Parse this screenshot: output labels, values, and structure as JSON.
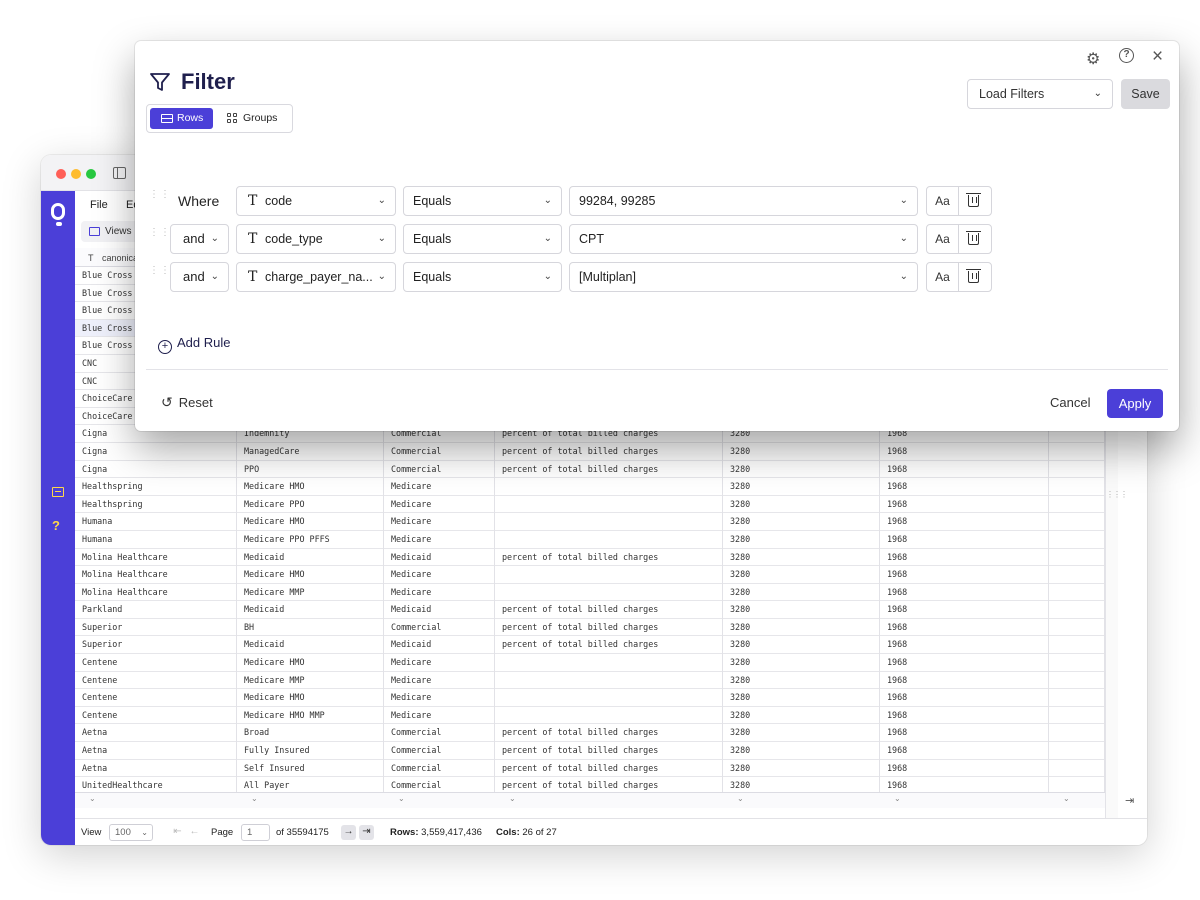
{
  "app": {
    "menu": [
      "File",
      "Ed"
    ],
    "views_label": "Views",
    "first_column_header": "canonica",
    "grid_rows": [
      [
        "Blue Cross",
        "",
        "",
        "",
        "",
        "",
        ""
      ],
      [
        "Blue Cross",
        "",
        "",
        "",
        "",
        "",
        ""
      ],
      [
        "Blue Cross",
        "",
        "",
        "",
        "",
        "",
        ""
      ],
      [
        "Blue Cross",
        "",
        "",
        "",
        "",
        "",
        ""
      ],
      [
        "Blue Cross",
        "",
        "",
        "",
        "",
        "",
        ""
      ],
      [
        "CNC",
        "",
        "",
        "",
        "",
        "",
        ""
      ],
      [
        "CNC",
        "",
        "",
        "",
        "",
        "",
        ""
      ],
      [
        "ChoiceCare",
        "",
        "",
        "",
        "",
        "",
        ""
      ],
      [
        "ChoiceCare",
        "",
        "",
        "",
        "",
        "",
        ""
      ],
      [
        "Cigna",
        "Indemnity",
        "Commercial",
        "percent of total billed charges",
        "3280",
        "1968",
        ""
      ],
      [
        "Cigna",
        "ManagedCare",
        "Commercial",
        "percent of total billed charges",
        "3280",
        "1968",
        ""
      ],
      [
        "Cigna",
        "PPO",
        "Commercial",
        "percent of total billed charges",
        "3280",
        "1968",
        ""
      ],
      [
        "Healthspring",
        "Medicare HMO",
        "Medicare",
        "",
        "3280",
        "1968",
        ""
      ],
      [
        "Healthspring",
        "Medicare PPO",
        "Medicare",
        "",
        "3280",
        "1968",
        ""
      ],
      [
        "Humana",
        "Medicare HMO",
        "Medicare",
        "",
        "3280",
        "1968",
        ""
      ],
      [
        "Humana",
        "Medicare PPO PFFS",
        "Medicare",
        "",
        "3280",
        "1968",
        ""
      ],
      [
        "Molina Healthcare",
        "Medicaid",
        "Medicaid",
        "percent of total billed charges",
        "3280",
        "1968",
        ""
      ],
      [
        "Molina Healthcare",
        "Medicare HMO",
        "Medicare",
        "",
        "3280",
        "1968",
        ""
      ],
      [
        "Molina Healthcare",
        "Medicare MMP",
        "Medicare",
        "",
        "3280",
        "1968",
        ""
      ],
      [
        "Parkland",
        "Medicaid",
        "Medicaid",
        "percent of total billed charges",
        "3280",
        "1968",
        ""
      ],
      [
        "Superior",
        "BH",
        "Commercial",
        "percent of total billed charges",
        "3280",
        "1968",
        ""
      ],
      [
        "Superior",
        "Medicaid",
        "Medicaid",
        "percent of total billed charges",
        "3280",
        "1968",
        ""
      ],
      [
        "Centene",
        "Medicare HMO",
        "Medicare",
        "",
        "3280",
        "1968",
        ""
      ],
      [
        "Centene",
        "Medicare MMP",
        "Medicare",
        "",
        "3280",
        "1968",
        ""
      ],
      [
        "Centene",
        "Medicare HMO",
        "Medicare",
        "",
        "3280",
        "1968",
        ""
      ],
      [
        "Centene",
        "Medicare HMO MMP",
        "Medicare",
        "",
        "3280",
        "1968",
        ""
      ],
      [
        "Aetna",
        "Broad",
        "Commercial",
        "percent of total billed charges",
        "3280",
        "1968",
        ""
      ],
      [
        "Aetna",
        "Fully Insured",
        "Commercial",
        "percent of total billed charges",
        "3280",
        "1968",
        ""
      ],
      [
        "Aetna",
        "Self Insured",
        "Commercial",
        "percent of total billed charges",
        "3280",
        "1968",
        ""
      ],
      [
        "UnitedHealthcare",
        "All Payer",
        "Commercial",
        "percent of total billed charges",
        "3280",
        "1968",
        ""
      ]
    ],
    "selected_rows": [
      3
    ],
    "status": {
      "view_label": "View",
      "view_value": "100",
      "page_label": "Page",
      "page_value": "1",
      "of_pages": "of 35594175",
      "rows_label": "Rows:",
      "rows_value": "3,559,417,436",
      "cols_label": "Cols:",
      "cols_value": "26 of 27"
    }
  },
  "dialog": {
    "title": "Filter",
    "tabs": {
      "rows": "Rows",
      "groups": "Groups"
    },
    "load_filters": "Load Filters",
    "save": "Save",
    "where": "Where",
    "rules": [
      {
        "conjunction": "",
        "field": "code",
        "operator": "Equals",
        "value": "99284, 99285"
      },
      {
        "conjunction": "and",
        "field": "code_type",
        "operator": "Equals",
        "value": "CPT"
      },
      {
        "conjunction": "and",
        "field": "charge_payer_na...",
        "operator": "Equals",
        "value": "[Multiplan]"
      }
    ],
    "case_label": "Aa",
    "add_rule": "Add Rule",
    "reset": "Reset",
    "cancel": "Cancel",
    "apply": "Apply"
  },
  "colors": {
    "accent": "#4b3fd8",
    "title": "#1f1f4d",
    "rail_icon": "#ffd84a"
  },
  "icons": [
    "settings-icon",
    "help-icon",
    "close-icon",
    "funnel-icon",
    "rows-icon",
    "groups-icon",
    "drag-handle-icon",
    "text-type-icon",
    "chevron-down-icon",
    "case-sensitive-icon",
    "trash-icon",
    "add-circle-icon",
    "reset-icon"
  ]
}
